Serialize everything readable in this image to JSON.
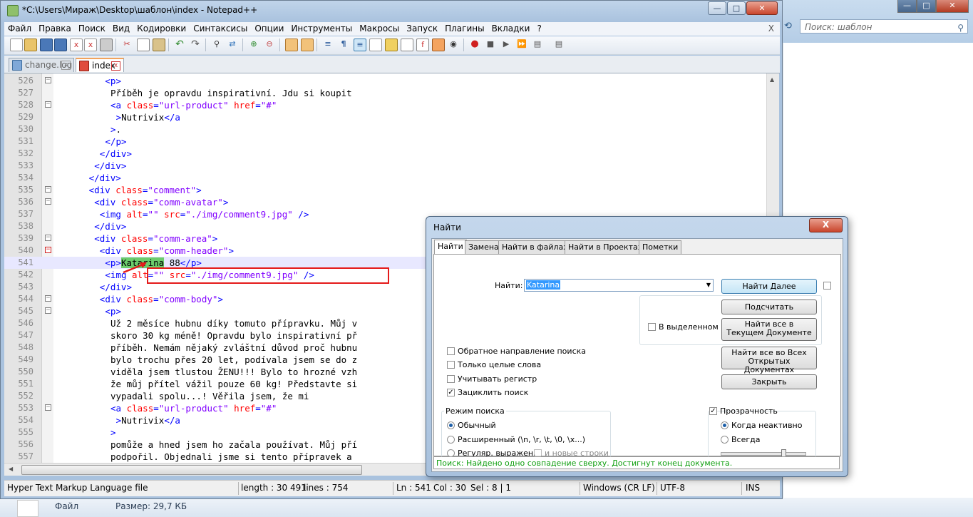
{
  "explorer": {
    "search_placeholder": "Поиск: шаблон",
    "footer_file_label": "Файл",
    "footer_size": "Размер: 29,7 КБ"
  },
  "window": {
    "title": "*C:\\Users\\Мираж\\Desktop\\шаблон\\index - Notepad++"
  },
  "menu": {
    "items": [
      "Файл",
      "Правка",
      "Поиск",
      "Вид",
      "Кодировки",
      "Синтаксисы",
      "Опции",
      "Инструменты",
      "Макросы",
      "Запуск",
      "Плагины",
      "Вкладки",
      "?"
    ],
    "close": "X"
  },
  "tabs": [
    {
      "label": "change.log",
      "active": false
    },
    {
      "label": "index",
      "active": true
    }
  ],
  "editor": {
    "lines": [
      {
        "n": "526",
        "code": "<p>"
      },
      {
        "n": "527",
        "code": "Příběh je opravdu inspirativní. Jdu si koupit"
      },
      {
        "n": "528",
        "code": "<a class=\"url-product\" href=\"#\""
      },
      {
        "n": "529",
        "code": ">Nutrivix</a"
      },
      {
        "n": "530",
        "code": ">."
      },
      {
        "n": "531",
        "code": "</p>"
      },
      {
        "n": "532",
        "code": "</div>"
      },
      {
        "n": "533",
        "code": "</div>"
      },
      {
        "n": "534",
        "code": "</div>"
      },
      {
        "n": "535",
        "code": "<div class=\"comment\">"
      },
      {
        "n": "536",
        "code": "<div class=\"comm-avatar\">"
      },
      {
        "n": "537",
        "code": "<img alt=\"\" src=\"./img/comment9.jpg\" />"
      },
      {
        "n": "538",
        "code": "</div>"
      },
      {
        "n": "539",
        "code": "<div class=\"comm-area\">"
      },
      {
        "n": "540",
        "code": "<div class=\"comm-header\">"
      },
      {
        "n": "541",
        "code": "<p>Katarina 88</p>"
      },
      {
        "n": "542",
        "code": "<img alt=\"\" src=\"./img/comment9.jpg\" />"
      },
      {
        "n": "543",
        "code": "</div>"
      },
      {
        "n": "544",
        "code": "<div class=\"comm-body\">"
      },
      {
        "n": "545",
        "code": "<p>"
      },
      {
        "n": "546",
        "code": "Už 2 měsíce hubnu díky tomuto přípravku. Můj v"
      },
      {
        "n": "547",
        "code": "skoro 30 kg méně! Opravdu bylo inspirativní př"
      },
      {
        "n": "548",
        "code": "příběh. Nemám nějaký zvláštní důvod proč hubnu"
      },
      {
        "n": "549",
        "code": "bylo trochu přes 20 let, podívala jsem se do z"
      },
      {
        "n": "550",
        "code": "viděla jsem tlustou ŽENU!!! Bylo to hrozné vzh"
      },
      {
        "n": "551",
        "code": "že můj přítel vážil pouze 60 kg! Představte si"
      },
      {
        "n": "552",
        "code": "vypadali spolu...! Věřila jsem, že mi"
      },
      {
        "n": "553",
        "code": "<a class=\"url-product\" href=\"#\""
      },
      {
        "n": "554",
        "code": ">Nutrivix</a"
      },
      {
        "n": "555",
        "code": ">"
      },
      {
        "n": "556",
        "code": "pomůže a hned jsem ho začala používat. Můj pří"
      },
      {
        "n": "557",
        "code": "podpořil. Objednali jsme si tento přípravek a"
      }
    ],
    "highlight": "Katarina"
  },
  "statusbar": {
    "filetype": "Hyper Text Markup Language file",
    "length": "length : 30 491",
    "lines": "lines : 754",
    "ln": "Ln : 541",
    "col": "Col : 30",
    "sel": "Sel : 8 | 1",
    "eol": "Windows (CR LF)",
    "encoding": "UTF-8",
    "ins": "INS"
  },
  "find_dialog": {
    "title": "Найти",
    "close": "X",
    "tabs": [
      "Найти",
      "Замена",
      "Найти в файлах",
      "Найти в Проектах",
      "Пометки"
    ],
    "find_label": "Найти:",
    "find_value": "Katarina",
    "btn_find_next": "Найти Далее",
    "btn_count": "Подсчитать",
    "btn_find_all_current": [
      "Найти все в",
      "Текущем Документе"
    ],
    "btn_find_all_open": [
      "Найти все во Всех",
      "Открытых Документах"
    ],
    "btn_close": "Закрыть",
    "in_selection": "В выделенном",
    "opt_backward": "Обратное направление поиска",
    "opt_whole_word": "Только целые слова",
    "opt_match_case": "Учитывать регистр",
    "opt_wrap": "Зациклить поиск",
    "search_mode_title": "Режим поиска",
    "mode_normal": "Обычный",
    "mode_extended": "Расширенный (\\n, \\r, \\t, \\0, \\x...)",
    "mode_regex": "Регуляр. выражен.",
    "mode_newline": "и новые строки",
    "transparency": "Прозрачность",
    "trans_inactive": "Когда неактивно",
    "trans_always": "Всегда",
    "status": "Поиск: Найдено одно совпадение сверху. Достигнут конец документа."
  }
}
